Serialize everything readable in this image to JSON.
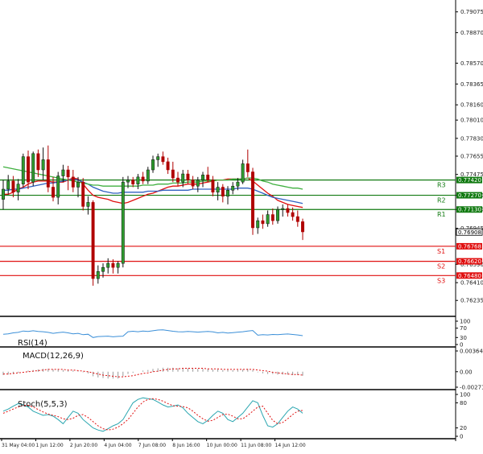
{
  "chart_data": {
    "type": "candlestick",
    "price_axis": {
      "ticks": [
        "0.79075",
        "0.78870",
        "0.78570",
        "0.78365",
        "0.78160",
        "0.78010",
        "0.77830",
        "0.77655",
        "0.77475",
        "0.77270",
        "0.77130",
        "0.76945",
        "0.76590",
        "0.76410",
        "0.76235"
      ],
      "ylim": [
        0.7611,
        0.7916
      ]
    },
    "time_axis": {
      "labels": [
        "31 May 04:00",
        "1 Jun 12:00",
        "2 Jun 20:00",
        "4 Jun 04:00",
        "7 Jun 08:00",
        "8 Jun 16:00",
        "10 Jun 00:00",
        "11 Jun 08:00",
        "14 Jun 12:00"
      ]
    },
    "candles": [
      {
        "o": 0.7723,
        "h": 0.7742,
        "l": 0.7713,
        "c": 0.7733
      },
      {
        "o": 0.7733,
        "h": 0.7747,
        "l": 0.7728,
        "c": 0.7741
      },
      {
        "o": 0.7741,
        "h": 0.7746,
        "l": 0.7725,
        "c": 0.773
      },
      {
        "o": 0.773,
        "h": 0.7743,
        "l": 0.7722,
        "c": 0.7738
      },
      {
        "o": 0.7738,
        "h": 0.7768,
        "l": 0.7735,
        "c": 0.7765
      },
      {
        "o": 0.7765,
        "h": 0.7771,
        "l": 0.7733,
        "c": 0.774
      },
      {
        "o": 0.774,
        "h": 0.777,
        "l": 0.7736,
        "c": 0.7768
      },
      {
        "o": 0.7768,
        "h": 0.7772,
        "l": 0.7745,
        "c": 0.7752
      },
      {
        "o": 0.7752,
        "h": 0.7774,
        "l": 0.7742,
        "c": 0.7762
      },
      {
        "o": 0.7762,
        "h": 0.7776,
        "l": 0.773,
        "c": 0.7735
      },
      {
        "o": 0.7735,
        "h": 0.7745,
        "l": 0.7721,
        "c": 0.7725
      },
      {
        "o": 0.7725,
        "h": 0.775,
        "l": 0.7718,
        "c": 0.7746
      },
      {
        "o": 0.7746,
        "h": 0.7757,
        "l": 0.774,
        "c": 0.7752
      },
      {
        "o": 0.7752,
        "h": 0.7756,
        "l": 0.7732,
        "c": 0.7745
      },
      {
        "o": 0.7745,
        "h": 0.7752,
        "l": 0.773,
        "c": 0.7735
      },
      {
        "o": 0.7735,
        "h": 0.7745,
        "l": 0.7725,
        "c": 0.774
      },
      {
        "o": 0.774,
        "h": 0.7744,
        "l": 0.7712,
        "c": 0.7716
      },
      {
        "o": 0.7716,
        "h": 0.7726,
        "l": 0.7708,
        "c": 0.772
      },
      {
        "o": 0.772,
        "h": 0.7722,
        "l": 0.7638,
        "c": 0.7645
      },
      {
        "o": 0.7645,
        "h": 0.7658,
        "l": 0.764,
        "c": 0.7652
      },
      {
        "o": 0.7652,
        "h": 0.766,
        "l": 0.7646,
        "c": 0.7656
      },
      {
        "o": 0.7656,
        "h": 0.7665,
        "l": 0.765,
        "c": 0.766
      },
      {
        "o": 0.766,
        "h": 0.7664,
        "l": 0.765,
        "c": 0.7656
      },
      {
        "o": 0.7656,
        "h": 0.7662,
        "l": 0.765,
        "c": 0.766
      },
      {
        "o": 0.766,
        "h": 0.7745,
        "l": 0.7656,
        "c": 0.774
      },
      {
        "o": 0.774,
        "h": 0.7746,
        "l": 0.7734,
        "c": 0.7742
      },
      {
        "o": 0.7742,
        "h": 0.7745,
        "l": 0.7735,
        "c": 0.7738
      },
      {
        "o": 0.7738,
        "h": 0.7748,
        "l": 0.7733,
        "c": 0.7745
      },
      {
        "o": 0.7745,
        "h": 0.775,
        "l": 0.7738,
        "c": 0.7741
      },
      {
        "o": 0.7741,
        "h": 0.7755,
        "l": 0.7738,
        "c": 0.7752
      },
      {
        "o": 0.7752,
        "h": 0.7766,
        "l": 0.7749,
        "c": 0.7762
      },
      {
        "o": 0.7762,
        "h": 0.7768,
        "l": 0.7755,
        "c": 0.7765
      },
      {
        "o": 0.7765,
        "h": 0.777,
        "l": 0.7757,
        "c": 0.776
      },
      {
        "o": 0.776,
        "h": 0.7764,
        "l": 0.7748,
        "c": 0.7752
      },
      {
        "o": 0.7752,
        "h": 0.776,
        "l": 0.774,
        "c": 0.7744
      },
      {
        "o": 0.7744,
        "h": 0.775,
        "l": 0.7736,
        "c": 0.774
      },
      {
        "o": 0.774,
        "h": 0.7752,
        "l": 0.7735,
        "c": 0.7748
      },
      {
        "o": 0.7748,
        "h": 0.7752,
        "l": 0.7738,
        "c": 0.7742
      },
      {
        "o": 0.7742,
        "h": 0.7746,
        "l": 0.7733,
        "c": 0.7736
      },
      {
        "o": 0.7736,
        "h": 0.7745,
        "l": 0.773,
        "c": 0.7742
      },
      {
        "o": 0.7742,
        "h": 0.775,
        "l": 0.7735,
        "c": 0.7747
      },
      {
        "o": 0.7747,
        "h": 0.7755,
        "l": 0.774,
        "c": 0.7742
      },
      {
        "o": 0.7742,
        "h": 0.7746,
        "l": 0.7726,
        "c": 0.773
      },
      {
        "o": 0.773,
        "h": 0.774,
        "l": 0.7722,
        "c": 0.7735
      },
      {
        "o": 0.7735,
        "h": 0.7738,
        "l": 0.772,
        "c": 0.7726
      },
      {
        "o": 0.7726,
        "h": 0.7736,
        "l": 0.7718,
        "c": 0.7732
      },
      {
        "o": 0.7732,
        "h": 0.774,
        "l": 0.7728,
        "c": 0.7736
      },
      {
        "o": 0.7736,
        "h": 0.7744,
        "l": 0.7732,
        "c": 0.774
      },
      {
        "o": 0.774,
        "h": 0.7762,
        "l": 0.7738,
        "c": 0.7758
      },
      {
        "o": 0.7758,
        "h": 0.7772,
        "l": 0.7745,
        "c": 0.775
      },
      {
        "o": 0.775,
        "h": 0.7754,
        "l": 0.7688,
        "c": 0.7695
      },
      {
        "o": 0.7695,
        "h": 0.7705,
        "l": 0.7689,
        "c": 0.7702
      },
      {
        "o": 0.7702,
        "h": 0.7708,
        "l": 0.7694,
        "c": 0.7699
      },
      {
        "o": 0.7699,
        "h": 0.7712,
        "l": 0.7696,
        "c": 0.7708
      },
      {
        "o": 0.7708,
        "h": 0.7714,
        "l": 0.7698,
        "c": 0.7702
      },
      {
        "o": 0.7702,
        "h": 0.7716,
        "l": 0.7699,
        "c": 0.7713
      },
      {
        "o": 0.7713,
        "h": 0.7718,
        "l": 0.7706,
        "c": 0.7714
      },
      {
        "o": 0.7714,
        "h": 0.7718,
        "l": 0.7706,
        "c": 0.771
      },
      {
        "o": 0.771,
        "h": 0.7715,
        "l": 0.7702,
        "c": 0.7706
      },
      {
        "o": 0.7706,
        "h": 0.7712,
        "l": 0.7696,
        "c": 0.7701
      },
      {
        "o": 0.7701,
        "h": 0.7704,
        "l": 0.7683,
        "c": 0.7691
      }
    ],
    "moving_averages": [
      {
        "name": "",
        "color": "#e01010",
        "values": [
          0.7728,
          0.7728,
          0.773,
          0.7733,
          0.7735,
          0.7738,
          0.774,
          0.7741,
          0.7741,
          0.7741,
          0.774,
          0.774,
          0.774,
          0.7742,
          0.7744,
          0.7743,
          0.7738,
          0.7732,
          0.7727,
          0.7725,
          0.7724,
          0.7723,
          0.7721,
          0.772,
          0.7719,
          0.772,
          0.7722,
          0.7724,
          0.7726,
          0.7728,
          0.7729,
          0.7731,
          0.7733,
          0.7735,
          0.7736,
          0.7736,
          0.7737,
          0.7738,
          0.7738,
          0.7738,
          0.7739,
          0.774,
          0.7741,
          0.7742,
          0.7742,
          0.7743,
          0.7743,
          0.7743,
          0.7743,
          0.7744,
          0.7741,
          0.7737,
          0.7733,
          0.7729,
          0.7726,
          0.7722,
          0.772,
          0.7718,
          0.7717,
          0.7716,
          0.7715
        ]
      },
      {
        "name": "",
        "color": "#3060c0",
        "values": [
          0.7732,
          0.7732,
          0.7733,
          0.7733,
          0.7734,
          0.7735,
          0.7736,
          0.7737,
          0.7738,
          0.7739,
          0.7739,
          0.774,
          0.7741,
          0.7742,
          0.7743,
          0.7742,
          0.774,
          0.7738,
          0.7735,
          0.7733,
          0.7731,
          0.773,
          0.7729,
          0.7729,
          0.773,
          0.773,
          0.773,
          0.773,
          0.773,
          0.7731,
          0.7731,
          0.7731,
          0.7732,
          0.7732,
          0.7732,
          0.7732,
          0.7732,
          0.7732,
          0.7733,
          0.7733,
          0.7733,
          0.7733,
          0.7733,
          0.7733,
          0.7733,
          0.7733,
          0.7733,
          0.7734,
          0.7734,
          0.7734,
          0.7733,
          0.7731,
          0.7729,
          0.7727,
          0.7725,
          0.7724,
          0.7723,
          0.7722,
          0.7721,
          0.772,
          0.7719
        ]
      },
      {
        "name": "",
        "color": "#40b040",
        "values": [
          0.7755,
          0.7754,
          0.7753,
          0.7752,
          0.7751,
          0.775,
          0.7749,
          0.7748,
          0.7747,
          0.7746,
          0.7745,
          0.7744,
          0.7743,
          0.7742,
          0.7741,
          0.774,
          0.7739,
          0.7738,
          0.7737,
          0.7737,
          0.7736,
          0.7736,
          0.7736,
          0.7736,
          0.7736,
          0.7736,
          0.7736,
          0.7736,
          0.7737,
          0.7737,
          0.7737,
          0.7738,
          0.7738,
          0.7738,
          0.7739,
          0.7739,
          0.7739,
          0.774,
          0.774,
          0.774,
          0.7741,
          0.7741,
          0.7741,
          0.7742,
          0.7742,
          0.7742,
          0.7743,
          0.7743,
          0.7743,
          0.7744,
          0.7744,
          0.7743,
          0.7741,
          0.774,
          0.7738,
          0.7737,
          0.7736,
          0.7735,
          0.7734,
          0.7734,
          0.7733
        ]
      }
    ],
    "levels": [
      {
        "label": "R3",
        "value": 0.7742,
        "value_text": "0.77420",
        "color": "#117a11"
      },
      {
        "label": "R2",
        "value": 0.7727,
        "value_text": "0.77270",
        "color": "#117a11"
      },
      {
        "label": "R1",
        "value": 0.7713,
        "value_text": "0.77130",
        "color": "#117a11"
      },
      {
        "label": "S1",
        "value": 0.76768,
        "value_text": "0.76768",
        "color": "#e01010"
      },
      {
        "label": "S2",
        "value": 0.7662,
        "value_text": "0.76620",
        "color": "#e01010"
      },
      {
        "label": "S3",
        "value": 0.7648,
        "value_text": "0.76480",
        "color": "#e01010"
      }
    ],
    "current_price": {
      "value": 0.76908,
      "value_text": "0.76908"
    },
    "rsi": {
      "title": "RSI(14)",
      "ticks": [
        "100",
        "70",
        "30",
        "0"
      ],
      "ylim": [
        0,
        100
      ],
      "values": [
        44,
        46,
        50,
        52,
        58,
        56,
        59,
        56,
        55,
        52,
        48,
        51,
        53,
        50,
        46,
        48,
        42,
        44,
        30,
        34,
        35,
        36,
        33,
        35,
        36,
        55,
        57,
        55,
        58,
        56,
        59,
        62,
        63,
        60,
        57,
        55,
        54,
        56,
        55,
        53,
        55,
        56,
        54,
        50,
        52,
        49,
        51,
        53,
        55,
        58,
        60,
        40,
        42,
        41,
        43,
        42,
        44,
        45,
        43,
        41,
        38
      ]
    },
    "macd": {
      "title": "MACD(12,26,9)",
      "ticks": [
        "0.003643",
        "0.00",
        "-0.002716"
      ],
      "ylim": [
        -0.002716,
        0.003643
      ],
      "histogram": [
        -0.0006,
        -0.0005,
        -0.0004,
        -0.0002,
        0.0,
        0.0002,
        0.0003,
        0.0004,
        0.0005,
        0.0005,
        0.0004,
        0.0004,
        0.0003,
        0.0003,
        0.0002,
        0.0001,
        -0.0001,
        -0.0003,
        -0.0008,
        -0.001,
        -0.0011,
        -0.0012,
        -0.0012,
        -0.0012,
        -0.0008,
        -0.0004,
        -0.0002,
        0.0,
        0.0002,
        0.0003,
        0.0005,
        0.0006,
        0.0007,
        0.0007,
        0.0007,
        0.0006,
        0.0006,
        0.0006,
        0.0005,
        0.0005,
        0.0005,
        0.0005,
        0.0004,
        0.0004,
        0.0003,
        0.0003,
        0.0003,
        0.0003,
        0.0004,
        0.0005,
        0.0003,
        -0.0001,
        -0.0003,
        -0.0004,
        -0.0004,
        -0.0005,
        -0.0005,
        -0.0005,
        -0.0006,
        -0.0006,
        -0.0007
      ],
      "signal": [
        -0.0004,
        -0.0004,
        -0.0003,
        -0.0002,
        -0.0001,
        0.0,
        0.0001,
        0.0002,
        0.0003,
        0.0004,
        0.0004,
        0.0004,
        0.0004,
        0.0003,
        0.0003,
        0.0002,
        0.0001,
        0.0,
        -0.0002,
        -0.0004,
        -0.0006,
        -0.0007,
        -0.0008,
        -0.0009,
        -0.0009,
        -0.0008,
        -0.0007,
        -0.0005,
        -0.0003,
        -0.0002,
        0.0,
        0.0001,
        0.0003,
        0.0004,
        0.0005,
        0.0005,
        0.0006,
        0.0006,
        0.0006,
        0.0006,
        0.0006,
        0.0005,
        0.0005,
        0.0005,
        0.0004,
        0.0004,
        0.0004,
        0.0004,
        0.0004,
        0.0004,
        0.0004,
        0.0003,
        0.0002,
        0.0001,
        -0.0001,
        -0.0002,
        -0.0003,
        -0.0004,
        -0.0005,
        -0.0005,
        -0.0006
      ]
    },
    "stoch": {
      "title": "Stoch(5,5,3)",
      "ticks": [
        "100",
        "80",
        "20",
        "0"
      ],
      "ylim": [
        0,
        100
      ],
      "k": [
        60,
        65,
        72,
        78,
        75,
        70,
        60,
        55,
        50,
        52,
        48,
        40,
        30,
        45,
        60,
        55,
        40,
        30,
        20,
        15,
        12,
        18,
        25,
        30,
        40,
        60,
        80,
        88,
        92,
        90,
        88,
        82,
        75,
        70,
        72,
        75,
        68,
        55,
        45,
        35,
        30,
        38,
        50,
        60,
        55,
        40,
        35,
        45,
        55,
        70,
        85,
        80,
        50,
        25,
        22,
        30,
        45,
        60,
        70,
        65,
        55
      ],
      "d": [
        55,
        60,
        65,
        70,
        74,
        74,
        70,
        64,
        58,
        53,
        50,
        47,
        42,
        40,
        43,
        50,
        52,
        45,
        35,
        25,
        18,
        15,
        17,
        22,
        30,
        40,
        55,
        70,
        82,
        88,
        90,
        88,
        84,
        78,
        73,
        72,
        71,
        68,
        60,
        50,
        42,
        36,
        38,
        45,
        52,
        53,
        48,
        42,
        42,
        50,
        60,
        70,
        72,
        55,
        38,
        30,
        33,
        42,
        52,
        60,
        62
      ]
    }
  }
}
